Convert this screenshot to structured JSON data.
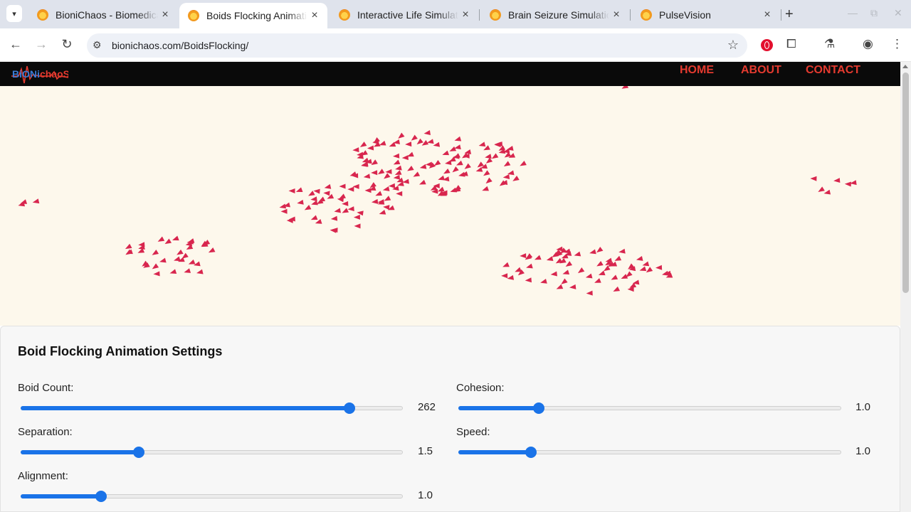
{
  "browser": {
    "tabs": [
      {
        "title": "BioniChaos - Biomedical",
        "active": false
      },
      {
        "title": "Boids Flocking Animation",
        "active": true
      },
      {
        "title": "Interactive Life Simulation",
        "active": false
      },
      {
        "title": "Brain Seizure Simulation",
        "active": false
      },
      {
        "title": "PulseVision",
        "active": false
      }
    ],
    "url": "bionichaos.com/BoidsFlocking/"
  },
  "site": {
    "logo_text": "BiONiChaoS",
    "nav": [
      "HOME",
      "ABOUT",
      "CONTACT"
    ],
    "accent_color": "#e43a2f"
  },
  "animation": {
    "boid_color": "#d8264e",
    "background": "#fdf8ec"
  },
  "settings": {
    "title": "Boid Flocking Animation Settings",
    "fields": [
      {
        "label": "Boid Count:",
        "value": "262",
        "fraction": 0.86
      },
      {
        "label": "Cohesion:",
        "value": "1.0",
        "fraction": 0.21
      },
      {
        "label": "Separation:",
        "value": "1.5",
        "fraction": 0.31
      },
      {
        "label": "Speed:",
        "value": "1.0",
        "fraction": 0.19
      },
      {
        "label": "Alignment:",
        "value": "1.0",
        "fraction": 0.21
      }
    ],
    "slider_color": "#1a73e8"
  }
}
